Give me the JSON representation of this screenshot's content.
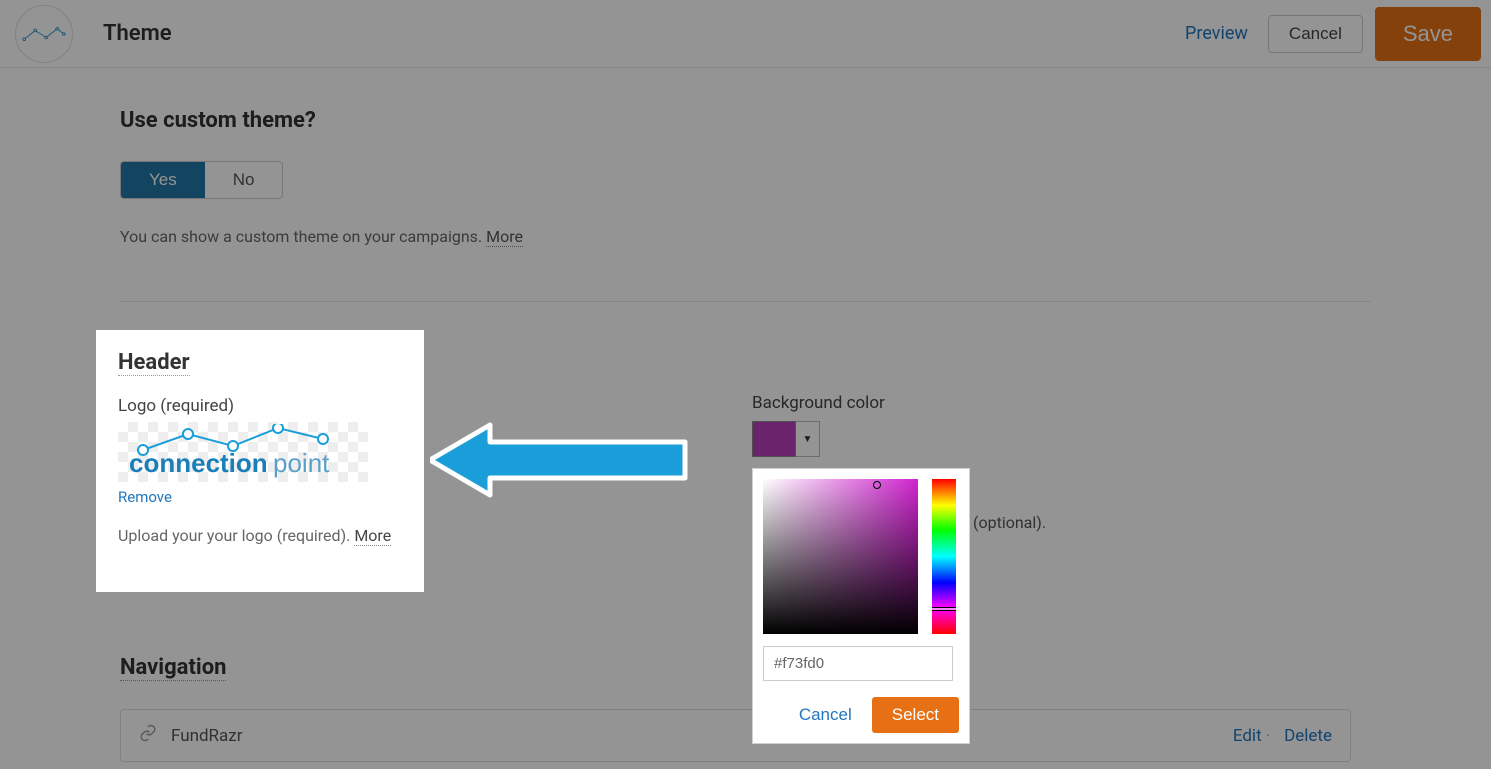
{
  "topbar": {
    "title": "Theme",
    "preview": "Preview",
    "cancel": "Cancel",
    "save": "Save"
  },
  "custom_theme": {
    "question": "Use custom theme?",
    "yes": "Yes",
    "no": "No",
    "helper": "You can show a custom theme on your campaigns.",
    "more": "More"
  },
  "header_section": {
    "title": "Header",
    "logo_label": "Logo (required)",
    "logo_text1": "connection",
    "logo_text2": "point",
    "remove": "Remove",
    "upload_hint": "Upload your your logo (required).",
    "more": "More"
  },
  "bg_section": {
    "label": "Background color",
    "swatch": "#b83fb8",
    "optional": "(optional)."
  },
  "color_picker": {
    "hex": "#f73fd0",
    "cancel": "Cancel",
    "select": "Select"
  },
  "navigation": {
    "title": "Navigation",
    "item": "FundRazr",
    "edit": "Edit",
    "delete": "Delete"
  }
}
